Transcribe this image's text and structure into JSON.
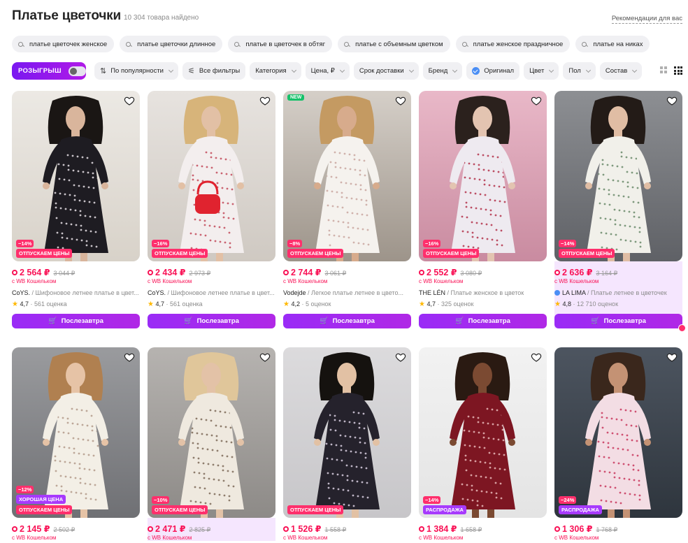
{
  "header": {
    "title": "Платье цветочки",
    "count": "10 304 товара найдено",
    "recommendations": "Рекомендации для вас"
  },
  "suggestions": [
    "платье цветочек женское",
    "платье цветочки длинное",
    "платье в цветочек в обтяг",
    "платье с объемным цветком",
    "платье женское праздничное",
    "платье на никах"
  ],
  "filters": {
    "raffle": "РОЗЫГРЫШ",
    "sort": "По популярности",
    "all_filters": "Все фильтры",
    "items": [
      "Категория",
      "Цена, ₽",
      "Срок доставки",
      "Бренд"
    ],
    "original": "Оригинал",
    "items2": [
      "Цвет",
      "Пол",
      "Состав"
    ]
  },
  "colors": {
    "accent": "#a73afd",
    "price": "#f91155"
  },
  "buy_label": "Послезавтра",
  "wallet_label": "с WB Кошельком",
  "products": [
    {
      "discount": "−14%",
      "promo": "ОТПУСКАЕМ ЦЕНЫ",
      "price": "2 564 ₽",
      "old": "3 044 ₽",
      "brand": "CoYS.",
      "name": " / Шифоновое летнее платье в цвет...",
      "rating": "4,7",
      "reviews": " · 561 оценка",
      "bg": [
        "#ece9e4",
        "#d8d2c9"
      ],
      "dress": "#1e1c22",
      "skin": "#d9b59c",
      "hair": "#1a1614",
      "pattern": "#e8e0e6"
    },
    {
      "discount": "−16%",
      "promo": "ОТПУСКАЕМ ЦЕНЫ",
      "price": "2 434 ₽",
      "old": "2 973 ₽",
      "brand": "CoYS.",
      "name": " / Шифоновое летнее платье в цвет...",
      "rating": "4,7",
      "reviews": " · 561 оценка",
      "bg": [
        "#e7e3df",
        "#cfc9c2"
      ],
      "dress": "#f3eeee",
      "skin": "#e2c0a5",
      "hair": "#d7b47a",
      "pattern": "#c24a5b",
      "bag": "#e0232f"
    },
    {
      "discount": "−8%",
      "promo": "ОТПУСКАЕМ ЦЕНЫ",
      "new": "NEW",
      "price": "2 744 ₽",
      "old": "3 061 ₽",
      "brand": "Vodejde",
      "name": " / Легкое платье летнее в цвето...",
      "rating": "4,2",
      "reviews": " · 5 оценок",
      "bg": [
        "#d5cfc8",
        "#9d948a"
      ],
      "dress": "#f5f2ee",
      "skin": "#d7ab8c",
      "hair": "#c49a62",
      "pattern": "#c9a7a0"
    },
    {
      "discount": "−16%",
      "promo": "ОТПУСКАЕМ ЦЕНЫ",
      "price": "2 552 ₽",
      "old": "3 080 ₽",
      "brand": "THE LÉN",
      "name": " / Платье женское в цветок",
      "rating": "4,7",
      "reviews": " · 325 оценок",
      "bg": [
        "#e9b8c8",
        "#c98ba0"
      ],
      "dress": "#eeeaf0",
      "skin": "#e3c4b1",
      "hair": "#2b211d",
      "pattern": "#b3324b"
    },
    {
      "discount": "−14%",
      "promo": "ОТПУСКАЕМ ЦЕНЫ",
      "price": "2 636 ₽",
      "old": "3 164 ₽",
      "brand": "LA LIMA",
      "verified": true,
      "name": " / Платье летнее в цветочек",
      "rating": "4,8",
      "reviews": " · 12 710 оценок",
      "bg": [
        "#8d8f93",
        "#5f6166"
      ],
      "dress": "#f1f0ea",
      "skin": "#e0bda4",
      "hair": "#231b17",
      "pattern": "#6a8a6a",
      "highlight": true
    },
    {
      "discount": "−12%",
      "promo": "ХОРОШАЯ ЦЕНА",
      "promo_type": "good",
      "promo2": "ОТПУСКАЕМ ЦЕНЫ",
      "price": "2 145 ₽",
      "old": "2 502 ₽",
      "bg": [
        "#9a9b9e",
        "#6f7074"
      ],
      "dress": "#f3efe6",
      "skin": "#e6c3a6",
      "hair": "#b08050",
      "pattern": "#b39a8a"
    },
    {
      "discount": "−10%",
      "promo": "ОТПУСКАЕМ ЦЕНЫ",
      "price": "2 471 ₽",
      "old": "2 825 ₽",
      "bg": [
        "#b6b3b0",
        "#8d8a87"
      ],
      "dress": "#efe9df",
      "skin": "#e3c2a7",
      "hair": "#e0c69a",
      "pattern": "#7d6a58",
      "highlight": true
    },
    {
      "promo": "ОТПУСКАЕМ ЦЕНЫ",
      "price": "1 526 ₽",
      "old": "1 558 ₽",
      "bg": [
        "#dcdbdd",
        "#c7c6c9"
      ],
      "dress": "#25222c",
      "skin": "#e2c1a4",
      "hair": "#15120f",
      "pattern": "#d9cfe2"
    },
    {
      "discount": "−14%",
      "promo": "РАСПРОДАЖА",
      "promo_type": "sale",
      "price": "1 384 ₽",
      "old": "1 658 ₽",
      "bg": [
        "#f2f2f2",
        "#e4e4e4"
      ],
      "dress": "#7d1622",
      "skin": "#7b4a32",
      "hair": "#2a1a12",
      "pattern": "#e8b9b9"
    },
    {
      "discount": "−24%",
      "promo": "РАСПРОДАЖА",
      "promo_type": "sale",
      "price": "1 306 ₽",
      "old": "1 768 ₽",
      "bg": [
        "#4d5560",
        "#2e353d"
      ],
      "dress": "#f3dde4",
      "skin": "#c49274",
      "hair": "#3a271c",
      "pattern": "#c8375d"
    }
  ]
}
